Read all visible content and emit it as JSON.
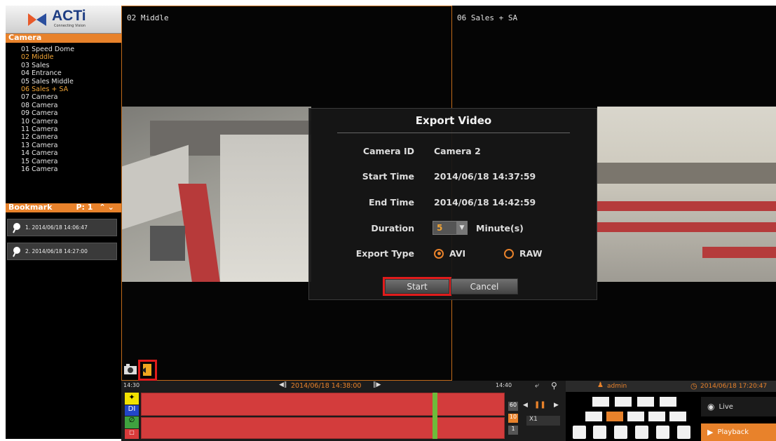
{
  "sidebar": {
    "logo": {
      "brand": "ACTi",
      "tagline": "Connecting Vision"
    },
    "camera_header": "Camera",
    "cameras": [
      "01 Speed Dome",
      "02 Middle",
      "03 Sales",
      "04 Entrance",
      "05 Sales Middle",
      "06 Sales + SA",
      "07 Camera",
      "08 Camera",
      "09 Camera",
      "10 Camera",
      "11 Camera",
      "12 Camera",
      "13 Camera",
      "14 Camera",
      "15 Camera",
      "16 Camera"
    ],
    "bookmark_header": "Bookmark",
    "bookmark_page": "P:  1",
    "bookmarks": [
      "1. 2014/06/18 14:06:47",
      "2. 2014/06/18 14:27:00"
    ]
  },
  "panes": {
    "left_title": "02 Middle",
    "right_title": "06 Sales + SA"
  },
  "dialog": {
    "title": "Export Video",
    "camera_id_label": "Camera ID",
    "camera_id": "Camera 2",
    "start_label": "Start Time",
    "start_time": "2014/06/18 14:37:59",
    "end_label": "End Time",
    "end_time": "2014/06/18 14:42:59",
    "duration_label": "Duration",
    "duration": "5",
    "duration_unit": "Minute(s)",
    "export_type_label": "Export Type",
    "option_avi": "AVI",
    "option_raw": "RAW",
    "start_button": "Start",
    "cancel_button": "Cancel"
  },
  "timeline": {
    "left_time": "14:30",
    "center_time": "2014/06/18 14:38:00",
    "right_time": "14:40",
    "scale": [
      "60",
      "10",
      "1"
    ],
    "speed": "X1",
    "track_labels": [
      "DI"
    ]
  },
  "control": {
    "user": "admin",
    "datetime": "2014/06/18 17:20:47",
    "live_label": "Live",
    "playback_label": "Playback"
  }
}
